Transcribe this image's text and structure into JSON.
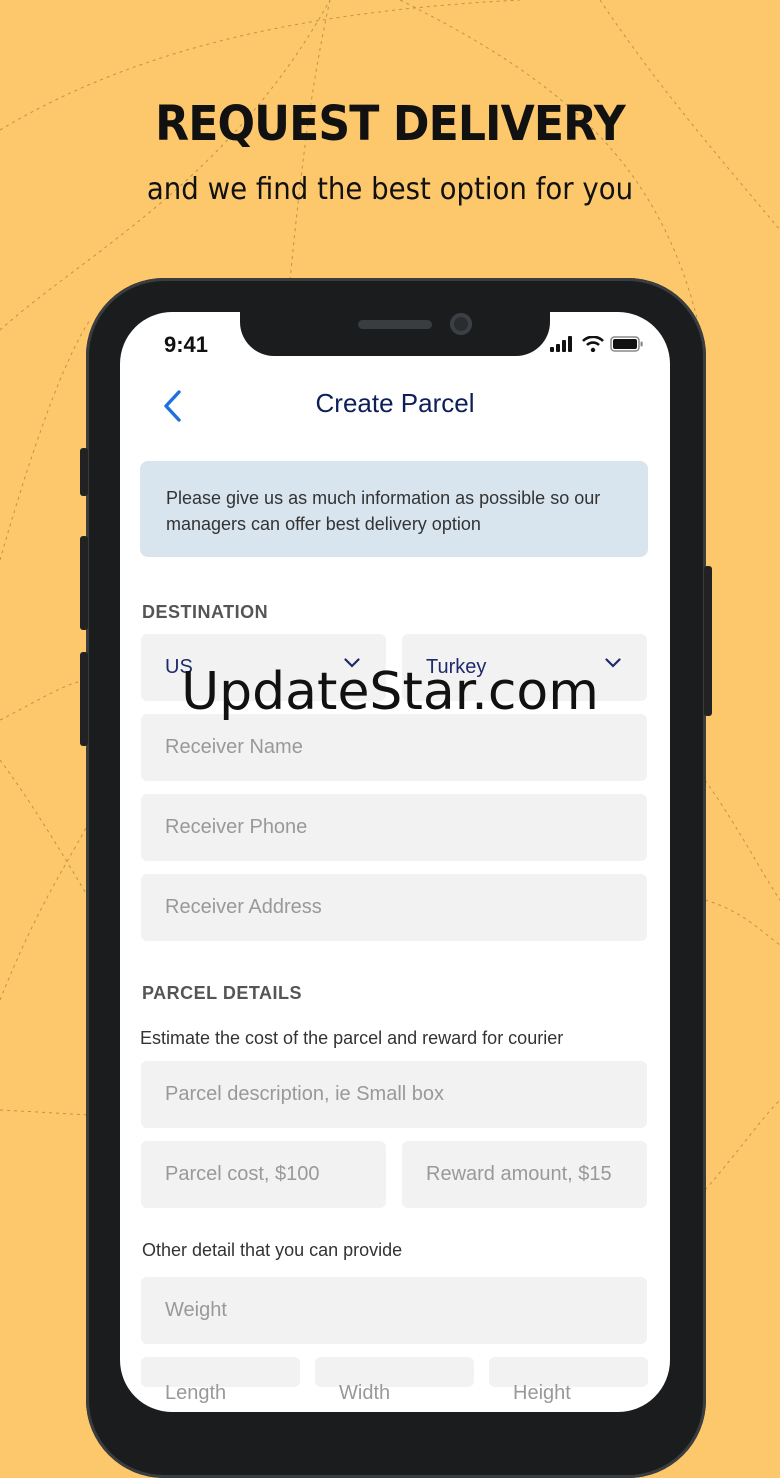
{
  "promo": {
    "headline": "REQUEST DELIVERY",
    "subline": "and we find the best option for you"
  },
  "status_bar": {
    "time": "9:41",
    "icons": [
      "signal-icon",
      "wifi-icon",
      "battery-icon"
    ]
  },
  "nav": {
    "title": "Create Parcel",
    "back_icon": "chevron-left-icon"
  },
  "info_message": "Please give us as much information as possible so our managers can offer best delivery option",
  "destination": {
    "section_label": "DESTINATION",
    "from_country": "US",
    "to_country": "Turkey",
    "receiver_name_placeholder": "Receiver Name",
    "receiver_phone_placeholder": "Receiver Phone",
    "receiver_address_placeholder": "Receiver Address"
  },
  "parcel_details": {
    "section_label": "PARCEL DETAILS",
    "hint": "Estimate the cost of the parcel and reward for courier",
    "description_placeholder": "Parcel description, ie Small box",
    "cost_placeholder": "Parcel cost, $100",
    "reward_placeholder": "Reward amount, $15",
    "other_hint": "Other detail that you can provide",
    "weight_placeholder": "Weight",
    "length_placeholder": "Length",
    "width_placeholder": "Width",
    "height_placeholder": "Height"
  },
  "watermark": "UpdateStar.com",
  "colors": {
    "background": "#FDC76C",
    "title": "#0E1E58",
    "accent": "#1E6FE0",
    "field": "#F2F2F2",
    "info": "#D8E4EE"
  }
}
